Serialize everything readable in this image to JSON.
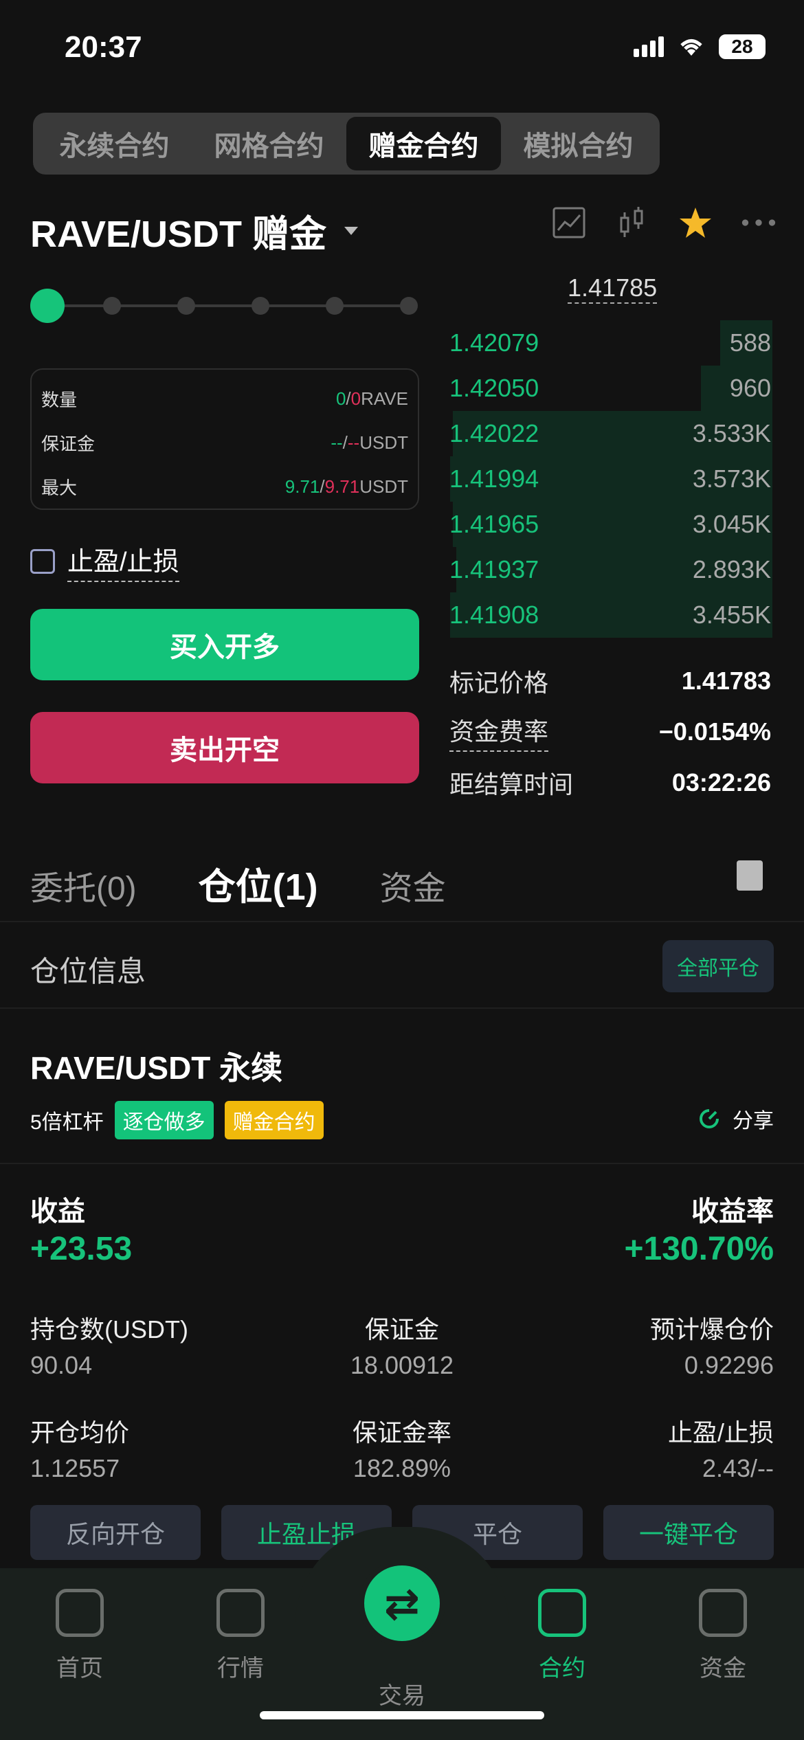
{
  "status": {
    "time": "20:37",
    "battery": "28"
  },
  "tabs": [
    "永续合约",
    "网格合约",
    "赠金合约",
    "模拟合约"
  ],
  "pair": {
    "name": "RAVE/USDT 赠金"
  },
  "slider": {
    "value": 0
  },
  "info": {
    "qty_label": "数量",
    "qty_a": "0",
    "qty_b": "0",
    "qty_unit": "RAVE",
    "margin_label": "保证金",
    "margin_a": "--",
    "margin_b": "--",
    "margin_unit": "USDT",
    "max_label": "最大",
    "max_a": "9.71",
    "max_b": "9.71",
    "max_unit": "USDT"
  },
  "tpsl_label": "止盈/止损",
  "buttons": {
    "buy": "买入开多",
    "sell": "卖出开空"
  },
  "orderbook": {
    "last_price": "1.41785",
    "rows": [
      {
        "price": "1.42079",
        "qty": "588",
        "depth": 0.16
      },
      {
        "price": "1.42050",
        "qty": "960",
        "depth": 0.22
      },
      {
        "price": "1.42022",
        "qty": "3.533K",
        "depth": 0.98
      },
      {
        "price": "1.41994",
        "qty": "3.573K",
        "depth": 0.99
      },
      {
        "price": "1.41965",
        "qty": "3.045K",
        "depth": 0.98
      },
      {
        "price": "1.41937",
        "qty": "2.893K",
        "depth": 0.97
      },
      {
        "price": "1.41908",
        "qty": "3.455K",
        "depth": 0.99
      }
    ]
  },
  "stats": {
    "mark_label": "标记价格",
    "mark_value": "1.41783",
    "funding_label": "资金费率",
    "funding_value": "−0.0154%",
    "settle_label": "距结算时间",
    "settle_value": "03:22:26"
  },
  "ptabs": {
    "orders": "委托(0)",
    "positions": "仓位(1)",
    "funds": "资金"
  },
  "posinfo": {
    "title": "仓位信息",
    "close_all": "全部平仓"
  },
  "position": {
    "title": "RAVE/USDT 永续",
    "leverage": "5倍杠杆",
    "tag1": "逐仓做多",
    "tag2": "赠金合约",
    "share": "分享",
    "pnl_label": "收益",
    "pnl_value": "+23.53",
    "roe_label": "收益率",
    "roe_value": "+130.70%",
    "size_label": "持仓数(USDT)",
    "size_value": "90.04",
    "margin_label": "保证金",
    "margin_value": "18.00912",
    "liq_label": "预计爆仓价",
    "liq_value": "0.92296",
    "entry_label": "开仓均价",
    "entry_value": "1.12557",
    "mratio_label": "保证金率",
    "mratio_value": "182.89%",
    "tpsl_label": "止盈/止损",
    "tpsl_value": "2.43/--"
  },
  "actions": {
    "reverse": "反向开仓",
    "tpsl": "止盈止损",
    "close": "平仓",
    "quick_close": "一键平仓"
  },
  "nav": {
    "home": "首页",
    "market": "行情",
    "trade": "交易",
    "futures": "合约",
    "assets": "资金"
  }
}
